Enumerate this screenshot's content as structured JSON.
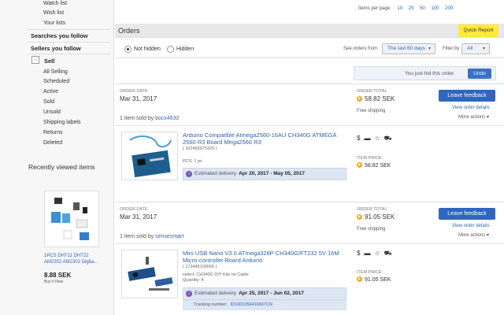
{
  "sidebar": {
    "links_top": [
      "Watch list",
      "Wish list",
      "Your lists"
    ],
    "searches_follow": "Searches you follow",
    "sellers_follow": "Sellers you follow",
    "sell_toggle": "-",
    "sell": "Sell",
    "sell_items": [
      "All Selling",
      "Scheduled",
      "Active",
      "Sold",
      "Unsold",
      "Shipping labels",
      "Returns",
      "Deleted"
    ],
    "recent_title": "Recently viewed items",
    "recent_item_name": "1PCS DHT11 DHT22 AM2302 AM2302 Digita...",
    "recent_item_price": "8.88 SEK",
    "recent_item_bin": "Buy It Now"
  },
  "pagination": {
    "label": "Items per page:",
    "options": [
      "10",
      "25",
      "50",
      "100",
      "200"
    ]
  },
  "orders_bar": {
    "title": "Orders",
    "quick_report": "Quick Report"
  },
  "filters": {
    "not_hidden": "Not hidden",
    "hidden": "Hidden",
    "see_orders_from": "See orders from",
    "period": "The last 60 days",
    "filter_by": "Filter by",
    "filter_value": "All"
  },
  "notice": {
    "text": "You just hid this order.",
    "undo": "Undo"
  },
  "orders": [
    {
      "date_label": "ORDER DATE",
      "date": "Mar 31, 2017",
      "total_label": "ORDER TOTAL",
      "total": "58.82 SEK",
      "shipping": "Free shipping",
      "leave_feedback": "Leave feedback",
      "view_details": "View order details",
      "more_actions": "More actions",
      "sold_by_prefix": "1 item sold by",
      "seller": "bocx4632",
      "item_title": "Arduino Compatible Atmega2560-16AU CH340G ATMEGA 2560 R3 Board Mega2560 R3",
      "item_id": "( 322465975329 )",
      "item_qty": "PCS: 1 pc",
      "delivery_prefix": "Estimated delivery",
      "delivery_dates": "Apr 20, 2017 - May 05, 2017",
      "item_price_label": "ITEM PRICE:",
      "item_price": "58.82 SEK",
      "icons": [
        "$",
        "▬",
        "☆",
        "⛟"
      ]
    },
    {
      "date_label": "ORDER DATE",
      "date": "Mar 31, 2017",
      "total_label": "ORDER TOTAL",
      "total": "91.05 SEK",
      "shipping": "Free shipping",
      "leave_feedback": "Leave feedback",
      "view_details": "View order details",
      "more_actions": "More actions",
      "sold_by_prefix": "1 item sold by",
      "seller": "sensesmart",
      "item_title": "Mini USB Nano V3.0 ATmega328P CH340G/FT232 5V 16M Micro-controller Board Arduino",
      "item_id": "( 172445100065 )",
      "item_variant": "select: CH340G DIY Kits no Cable",
      "item_qty": "Quantity: 4",
      "delivery_prefix": "Estimated delivery",
      "delivery_dates": "Apr 25, 2017 - Jun 02, 2017",
      "tracking_label": "Tracking number:",
      "tracking_number": "ID1601056416667CN",
      "item_price_label": "ITEM PRICE:",
      "item_price": "91.05 SEK",
      "icons": [
        "$",
        "▬",
        "☆",
        "⛟"
      ]
    }
  ]
}
